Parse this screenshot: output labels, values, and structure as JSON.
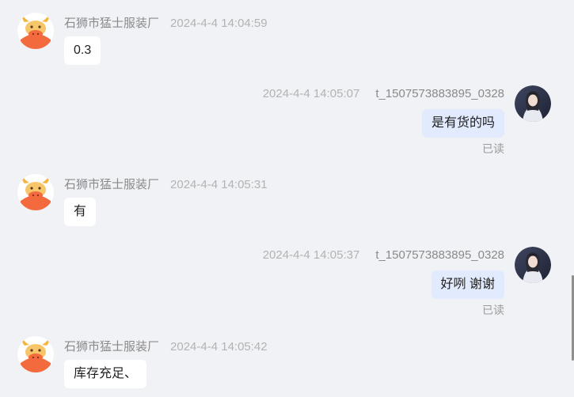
{
  "messages": [
    {
      "direction": "in",
      "sender": "石狮市猛士服装厂",
      "time": "2024-4-4 14:04:59",
      "text": "0.3"
    },
    {
      "direction": "out",
      "sender": "t_1507573883895_0328",
      "time": "2024-4-4 14:05:07",
      "text": "是有货的吗",
      "status": "已读"
    },
    {
      "direction": "in",
      "sender": "石狮市猛士服装厂",
      "time": "2024-4-4 14:05:31",
      "text": "有"
    },
    {
      "direction": "out",
      "sender": "t_1507573883895_0328",
      "time": "2024-4-4 14:05:37",
      "text": "好咧 谢谢",
      "status": "已读"
    },
    {
      "direction": "in",
      "sender": "石狮市猛士服装厂",
      "time": "2024-4-4 14:05:42",
      "text": "库存充足、"
    }
  ],
  "colors": {
    "background": "#f1f2f6",
    "incoming_bubble": "#ffffff",
    "outgoing_bubble": "#e2ebfe",
    "meta_text": "#9a9a9a",
    "avatar_orange": "#f26a3d"
  },
  "icons": {
    "incoming_avatar": "bull-mascot-avatar-icon",
    "outgoing_avatar": "user-photo-avatar-icon"
  }
}
